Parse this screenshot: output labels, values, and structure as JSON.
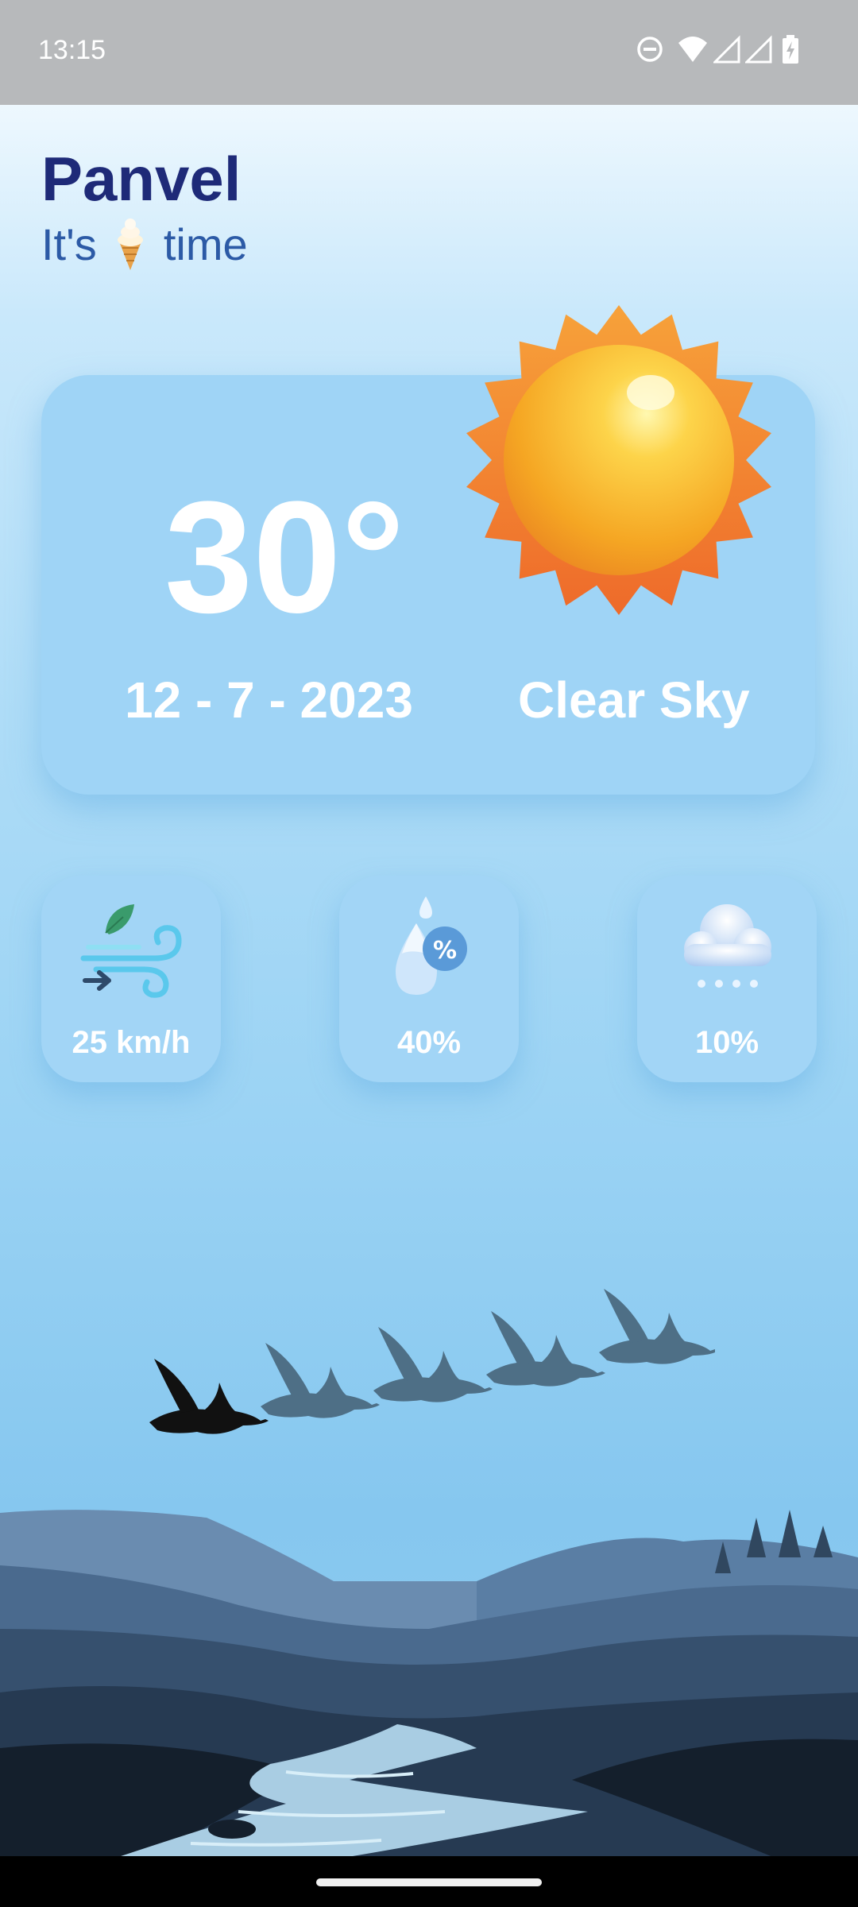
{
  "status_bar": {
    "time": "13:15",
    "icons": [
      "do-not-disturb-icon",
      "wifi-icon",
      "signal-icon",
      "signal-icon",
      "battery-charging-icon"
    ]
  },
  "header": {
    "city": "Panvel",
    "subtitle_prefix": "It's",
    "subtitle_emoji": "ice-cream-icon",
    "subtitle_suffix": "time"
  },
  "weather": {
    "temperature": "30°",
    "date": "12 - 7 - 2023",
    "condition": "Clear Sky",
    "icon": "sun-icon"
  },
  "stats": [
    {
      "icon": "wind-icon",
      "value": "25 km/h"
    },
    {
      "icon": "humidity-icon",
      "value": "40%"
    },
    {
      "icon": "snow-cloud-icon",
      "value": "10%"
    }
  ],
  "colors": {
    "city": "#1e2a78",
    "subtitle": "#2c5aa6",
    "card": "#9fd4f6",
    "text_on_card": "#ffffff"
  }
}
